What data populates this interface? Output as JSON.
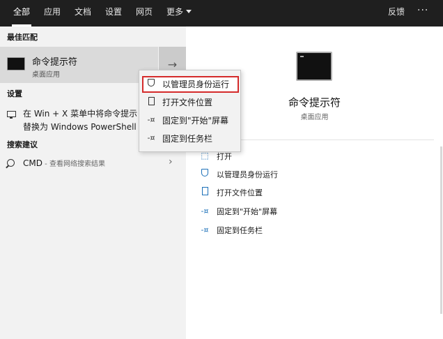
{
  "tabs": [
    {
      "label": "全部",
      "active": true
    },
    {
      "label": "应用"
    },
    {
      "label": "文档"
    },
    {
      "label": "设置"
    },
    {
      "label": "网页"
    },
    {
      "label": "更多"
    }
  ],
  "feedback_label": "反馈",
  "more_options": "···",
  "left": {
    "best_match_heading": "最佳匹配",
    "best_match": {
      "title": "命令提示符",
      "subtitle": "桌面应用",
      "arrow": "→"
    },
    "settings_heading": "设置",
    "setting_item": {
      "line1": "在 Win + X 菜单中将命令提示",
      "line2": "替换为 Windows PowerShell"
    },
    "search_heading": "搜索建议",
    "search_item": {
      "query": "CMD",
      "hint": " - 查看网络搜索结果",
      "chevron": "›"
    }
  },
  "context_menu": [
    {
      "label": "以管理员身份运行",
      "icon": "shield-icon",
      "highlighted": true
    },
    {
      "label": "打开文件位置",
      "icon": "document-icon"
    },
    {
      "label": "固定到\"开始\"屏幕",
      "icon": "pin-icon"
    },
    {
      "label": "固定到任务栏",
      "icon": "pin-icon"
    }
  ],
  "right": {
    "title": "命令提示符",
    "subtitle": "桌面应用",
    "actions": [
      {
        "label": "打开",
        "icon": "open-icon"
      },
      {
        "label": "以管理员身份运行",
        "icon": "shield-icon"
      },
      {
        "label": "打开文件位置",
        "icon": "document-icon"
      },
      {
        "label": "固定到\"开始\"屏幕",
        "icon": "pin-icon"
      },
      {
        "label": "固定到任务栏",
        "icon": "pin-icon"
      }
    ]
  },
  "colors": {
    "topbar": "#1f1f1f",
    "highlight_border": "#d42a2a",
    "accent": "#1a6fb8"
  }
}
